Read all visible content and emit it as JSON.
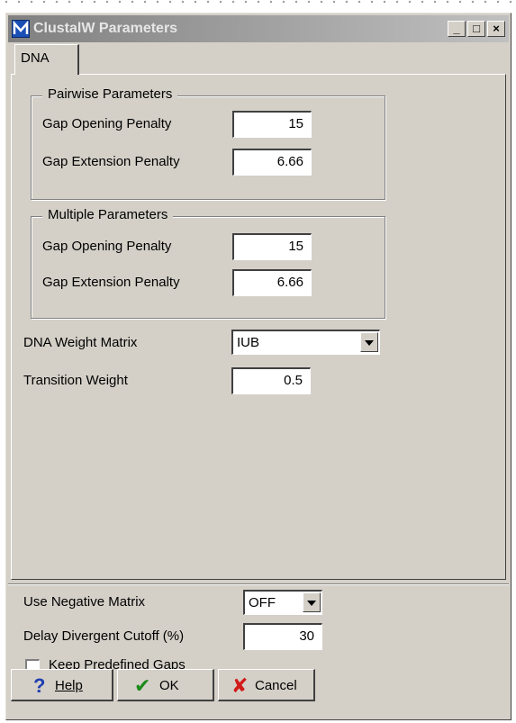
{
  "window": {
    "title": "ClustalW Parameters",
    "controls": [
      "_",
      "□",
      "×"
    ]
  },
  "tabs": [
    {
      "label": "DNA",
      "active": true
    }
  ],
  "pairwise": {
    "legend": "Pairwise Parameters",
    "gap_open_label": "Gap Opening Penalty",
    "gap_open_value": "15",
    "gap_ext_label": "Gap Extension Penalty",
    "gap_ext_value": "6.66"
  },
  "multiple": {
    "legend": "Multiple Parameters",
    "gap_open_label": "Gap Opening Penalty",
    "gap_open_value": "15",
    "gap_ext_label": "Gap Extension Penalty",
    "gap_ext_value": "6.66"
  },
  "dna_weight_matrix": {
    "label": "DNA Weight Matrix",
    "value": "IUB"
  },
  "transition_weight": {
    "label": "Transition Weight",
    "value": "0.5"
  },
  "negative_matrix": {
    "label": "Use Negative Matrix",
    "value": "OFF"
  },
  "delay_divergent": {
    "label": "Delay Divergent Cutoff (%)",
    "value": "30"
  },
  "keep_gaps": {
    "label": "Keep Predefined Gaps",
    "checked": false
  },
  "buttons": {
    "help": {
      "label": "Help",
      "icon": "question-icon",
      "color": "#1f3fb0"
    },
    "ok": {
      "label": "OK",
      "icon": "checkmark-icon",
      "color": "#1d8a1d"
    },
    "cancel": {
      "label": "Cancel",
      "icon": "x-icon",
      "color": "#d11a1a"
    }
  }
}
